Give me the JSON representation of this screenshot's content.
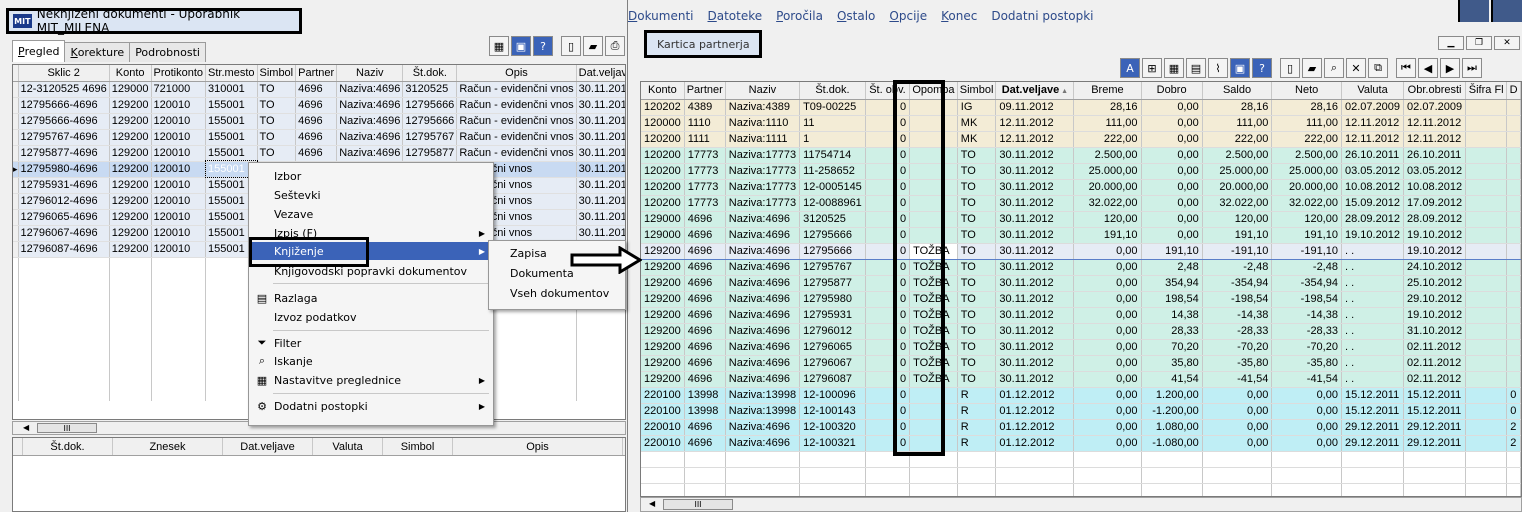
{
  "left_window": {
    "title": "Neknjiženi dokumenti - Uporabnik MIT_MILENA",
    "logo": "MIT",
    "tabs": [
      {
        "label": "Pregled",
        "underline": "P",
        "rest": "regled",
        "active": true
      },
      {
        "label": "Korekture",
        "underline": "K",
        "rest": "orekture",
        "active": false
      },
      {
        "label": "Podrobnosti",
        "underline": "",
        "rest": "Podrobnosti",
        "active": false
      }
    ],
    "toolbar_icons": [
      "layout-icon",
      "display-icon",
      "help-icon",
      "new-doc-icon",
      "open-folder-icon",
      "print-icon"
    ],
    "grid": {
      "columns": [
        "Sklic 2",
        "Konto",
        "Protikonto",
        "Str.mesto",
        "Simbol",
        "Partner",
        "Naziv",
        "Št.dok.",
        "Opis",
        "Dat.veljave"
      ],
      "rows": [
        [
          "12-3120525 4696",
          "129000",
          "721000",
          "310001",
          "TO",
          "4696",
          "Naziva:4696",
          "3120525",
          "Račun - evidenčni vnos",
          "30.11.2012"
        ],
        [
          "12795666-4696",
          "129200",
          "120010",
          "155001",
          "TO",
          "4696",
          "Naziva:4696",
          "12795666",
          "Račun - evidenčni vnos",
          "30.11.2012"
        ],
        [
          "12795666-4696",
          "129200",
          "120010",
          "155001",
          "TO",
          "4696",
          "Naziva:4696",
          "12795666",
          "Račun - evidenčni vnos",
          "30.11.2012"
        ],
        [
          "12795767-4696",
          "129200",
          "120010",
          "155001",
          "TO",
          "4696",
          "Naziva:4696",
          "12795767",
          "Račun - evidenčni vnos",
          "30.11.2012"
        ],
        [
          "12795877-4696",
          "129200",
          "120010",
          "155001",
          "TO",
          "4696",
          "Naziva:4696",
          "12795877",
          "Račun - evidenčni vnos",
          "30.11.2012"
        ],
        [
          "12795980-4696",
          "129200",
          "120010",
          "155001",
          "",
          "",
          "",
          "",
          "evidenčni vnos",
          "30.11.2012"
        ],
        [
          "12795931-4696",
          "129200",
          "120010",
          "155001",
          "",
          "",
          "",
          "",
          "evidenčni vnos",
          "30.11.2012"
        ],
        [
          "12796012-4696",
          "129200",
          "120010",
          "155001",
          "",
          "",
          "",
          "",
          "evidenčni vnos",
          "30.11.2012"
        ],
        [
          "12796065-4696",
          "129200",
          "120010",
          "155001",
          "",
          "",
          "",
          "",
          "evidenčni vnos",
          "30.11.2012"
        ],
        [
          "12796067-4696",
          "129200",
          "120010",
          "155001",
          "",
          "",
          "",
          "",
          "evidenčni vnos",
          "30.11.2012"
        ],
        [
          "12796087-4696",
          "129200",
          "120010",
          "155001",
          "",
          "",
          "",
          "",
          "evidenčni vnos",
          "30.11.2012"
        ]
      ]
    },
    "scroll_thumb": "III",
    "bottom_grid_columns": [
      "Št.dok.",
      "Znesek",
      "Dat.veljave",
      "Valuta",
      "Simbol",
      "Opis"
    ]
  },
  "context_menu": {
    "items": [
      {
        "label": "Izbor"
      },
      {
        "label": "Seštevki"
      },
      {
        "label": "Vezave"
      },
      {
        "label": "Izpis (F)",
        "submenu": true
      },
      {
        "label": "Knjiženje",
        "submenu": true,
        "highlighted": true
      },
      {
        "label": "Knjigovodski popravki dokumentov"
      },
      {
        "label": "Razlaga",
        "icon": "explanation-icon"
      },
      {
        "label": "Izvoz podatkov"
      },
      {
        "label": "Filter",
        "icon": "filter-icon"
      },
      {
        "label": "Iskanje",
        "icon": "search-icon"
      },
      {
        "label": "Nastavitve preglednice",
        "icon": "grid-settings-icon",
        "submenu": true
      },
      {
        "label": "Dodatni postopki",
        "icon": "extra-actions-icon",
        "submenu": true
      }
    ],
    "submenu_items": [
      "Zapisa",
      "Dokumenta",
      "Vseh dokumentov"
    ]
  },
  "right_window": {
    "menubar": [
      {
        "u": "D",
        "rest": "okumenti"
      },
      {
        "u": "D",
        "rest": "atoteke"
      },
      {
        "u": "P",
        "rest": "oročila"
      },
      {
        "u": "O",
        "rest": "stalo"
      },
      {
        "u": "O",
        "rest": "pcije"
      },
      {
        "u": "K",
        "rest": "onec"
      },
      {
        "u": "",
        "rest": "Dodatni postopki"
      }
    ],
    "title": "Kartica partnerja",
    "grid": {
      "columns": [
        "Konto",
        "Partner",
        "Naziv",
        "Št.dok.",
        "Št. obv.",
        "Opomba",
        "Simbol",
        "Dat.veljave",
        "Breme",
        "Dobro",
        "Saldo",
        "Neto",
        "Valuta",
        "Obr.obresti",
        "Šifra Fl",
        "D"
      ],
      "rows": [
        {
          "style": "y",
          "cells": [
            "120202",
            "4389",
            "Naziva:4389",
            "T09-00225",
            "0",
            "",
            "IG",
            "09.11.2012",
            "28,16",
            "0,00",
            "28,16",
            "28,16",
            "02.07.2009",
            "02.07.2009",
            "",
            ""
          ]
        },
        {
          "style": "y",
          "cells": [
            "120000",
            "1110",
            "Naziva:1110",
            "11",
            "0",
            "",
            "MK",
            "12.11.2012",
            "111,00",
            "0,00",
            "111,00",
            "111,00",
            "12.11.2012",
            "12.11.2012",
            "",
            ""
          ]
        },
        {
          "style": "y",
          "cells": [
            "120200",
            "1111",
            "Naziva:1111",
            "1",
            "0",
            "",
            "MK",
            "12.11.2012",
            "222,00",
            "0,00",
            "222,00",
            "222,00",
            "12.11.2012",
            "12.11.2012",
            "",
            ""
          ]
        },
        {
          "style": "g",
          "cells": [
            "120200",
            "17773",
            "Naziva:17773",
            "11754714",
            "0",
            "",
            "TO",
            "30.11.2012",
            "2.500,00",
            "0,00",
            "2.500,00",
            "2.500,00",
            "26.10.2011",
            "26.10.2011",
            "",
            ""
          ]
        },
        {
          "style": "g",
          "cells": [
            "120200",
            "17773",
            "Naziva:17773",
            "11-258652",
            "0",
            "",
            "TO",
            "30.11.2012",
            "25.000,00",
            "0,00",
            "25.000,00",
            "25.000,00",
            "03.05.2012",
            "03.05.2012",
            "",
            ""
          ]
        },
        {
          "style": "g",
          "cells": [
            "120200",
            "17773",
            "Naziva:17773",
            "12-0005145",
            "0",
            "",
            "TO",
            "30.11.2012",
            "20.000,00",
            "0,00",
            "20.000,00",
            "20.000,00",
            "10.08.2012",
            "10.08.2012",
            "",
            ""
          ]
        },
        {
          "style": "g",
          "cells": [
            "120200",
            "17773",
            "Naziva:17773",
            "12-0088961",
            "0",
            "",
            "TO",
            "30.11.2012",
            "32.022,00",
            "0,00",
            "32.022,00",
            "32.022,00",
            "15.09.2012",
            "17.09.2012",
            "",
            ""
          ]
        },
        {
          "style": "g",
          "cells": [
            "129000",
            "4696",
            "Naziva:4696",
            "3120525",
            "0",
            "",
            "TO",
            "30.11.2012",
            "120,00",
            "0,00",
            "120,00",
            "120,00",
            "28.09.2012",
            "28.09.2012",
            "",
            ""
          ]
        },
        {
          "style": "g",
          "cells": [
            "129000",
            "4696",
            "Naziva:4696",
            "12795666",
            "0",
            "",
            "TO",
            "30.11.2012",
            "191,10",
            "0,00",
            "191,10",
            "191,10",
            "19.10.2012",
            "19.10.2012",
            "",
            ""
          ]
        },
        {
          "style": "cur",
          "cells": [
            "129200",
            "4696",
            "Naziva:4696",
            "12795666",
            "0",
            "TOŽBA",
            "TO",
            "30.11.2012",
            "0,00",
            "191,10",
            "-191,10",
            "-191,10",
            ". .",
            "19.10.2012",
            "",
            ""
          ]
        },
        {
          "style": "g",
          "cells": [
            "129200",
            "4696",
            "Naziva:4696",
            "12795767",
            "0",
            "TOŽBA",
            "TO",
            "30.11.2012",
            "0,00",
            "2,48",
            "-2,48",
            "-2,48",
            ". .",
            "24.10.2012",
            "",
            ""
          ]
        },
        {
          "style": "g",
          "cells": [
            "129200",
            "4696",
            "Naziva:4696",
            "12795877",
            "0",
            "TOŽBA",
            "TO",
            "30.11.2012",
            "0,00",
            "354,94",
            "-354,94",
            "-354,94",
            ". .",
            "25.10.2012",
            "",
            ""
          ]
        },
        {
          "style": "g",
          "cells": [
            "129200",
            "4696",
            "Naziva:4696",
            "12795980",
            "0",
            "TOŽBA",
            "TO",
            "30.11.2012",
            "0,00",
            "198,54",
            "-198,54",
            "-198,54",
            ". .",
            "29.10.2012",
            "",
            ""
          ]
        },
        {
          "style": "g",
          "cells": [
            "129200",
            "4696",
            "Naziva:4696",
            "12795931",
            "0",
            "TOŽBA",
            "TO",
            "30.11.2012",
            "0,00",
            "14,38",
            "-14,38",
            "-14,38",
            ". .",
            "19.10.2012",
            "",
            ""
          ]
        },
        {
          "style": "g",
          "cells": [
            "129200",
            "4696",
            "Naziva:4696",
            "12796012",
            "0",
            "TOŽBA",
            "TO",
            "30.11.2012",
            "0,00",
            "28,33",
            "-28,33",
            "-28,33",
            ". .",
            "31.10.2012",
            "",
            ""
          ]
        },
        {
          "style": "g",
          "cells": [
            "129200",
            "4696",
            "Naziva:4696",
            "12796065",
            "0",
            "TOŽBA",
            "TO",
            "30.11.2012",
            "0,00",
            "70,20",
            "-70,20",
            "-70,20",
            ". .",
            "02.11.2012",
            "",
            ""
          ]
        },
        {
          "style": "g",
          "cells": [
            "129200",
            "4696",
            "Naziva:4696",
            "12796067",
            "0",
            "TOŽBA",
            "TO",
            "30.11.2012",
            "0,00",
            "35,80",
            "-35,80",
            "-35,80",
            ". .",
            "02.11.2012",
            "",
            ""
          ]
        },
        {
          "style": "g",
          "cells": [
            "129200",
            "4696",
            "Naziva:4696",
            "12796087",
            "0",
            "TOŽBA",
            "TO",
            "30.11.2012",
            "0,00",
            "41,54",
            "-41,54",
            "-41,54",
            ". .",
            "02.11.2012",
            "",
            ""
          ]
        },
        {
          "style": "b",
          "cells": [
            "220100",
            "13998",
            "Naziva:13998",
            "12-100096",
            "0",
            "",
            "R",
            "01.12.2012",
            "0,00",
            "1.200,00",
            "0,00",
            "0,00",
            "15.12.2011",
            "15.12.2011",
            "",
            "0"
          ]
        },
        {
          "style": "b",
          "cells": [
            "220100",
            "13998",
            "Naziva:13998",
            "12-100143",
            "0",
            "",
            "R",
            "01.12.2012",
            "0,00",
            "-1.200,00",
            "0,00",
            "0,00",
            "15.12.2011",
            "15.12.2011",
            "",
            "0"
          ]
        },
        {
          "style": "b",
          "cells": [
            "220010",
            "4696",
            "Naziva:4696",
            "12-100320",
            "0",
            "",
            "R",
            "01.12.2012",
            "0,00",
            "1.080,00",
            "0,00",
            "0,00",
            "29.12.2011",
            "29.12.2011",
            "",
            "2"
          ]
        },
        {
          "style": "b",
          "cells": [
            "220010",
            "4696",
            "Naziva:4696",
            "12-100321",
            "0",
            "",
            "R",
            "01.12.2012",
            "0,00",
            "-1.080,00",
            "0,00",
            "0,00",
            "29.12.2011",
            "29.12.2011",
            "",
            "2"
          ]
        }
      ]
    },
    "scroll_thumb": "III"
  },
  "colors": {
    "row_yellow": "#f3ecd6",
    "row_green": "#cff0e6",
    "row_blue": "#bfeef5",
    "selection": "#3b63b8",
    "annotation": "#000000"
  }
}
